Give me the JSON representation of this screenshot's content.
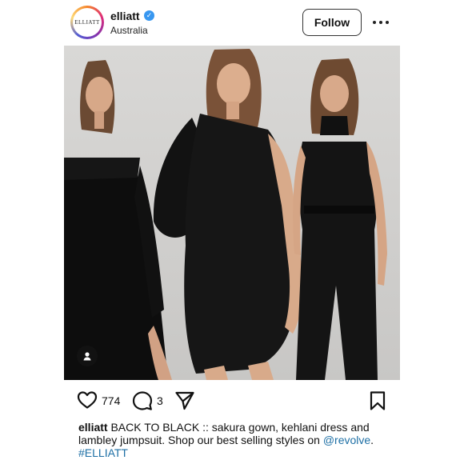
{
  "account": {
    "username": "elliatt",
    "avatar_text": "ELLIATT",
    "location": "Australia",
    "verified": true
  },
  "header": {
    "follow_label": "Follow",
    "more_icon": "more-horizontal-icon"
  },
  "photo": {
    "alt": "Three models in black outfits: off-shoulder gown, sequin one-shoulder dress, high-neck jumpsuit",
    "tag_icon": "user-tag-icon"
  },
  "actions": {
    "like_icon": "heart-icon",
    "like_count": "774",
    "comment_icon": "comment-icon",
    "comment_count": "3",
    "share_icon": "send-icon",
    "save_icon": "bookmark-icon"
  },
  "caption": {
    "username": "elliatt",
    "text": " BACK TO BLACK :: sakura gown, kehlani dress and lambley jumpsuit. Shop our best selling styles on ",
    "mention": "@revolve",
    "end": ".",
    "hashtag": "#ELLIATT"
  },
  "colors": {
    "link": "#1d6fa5",
    "verified": "#3897f0"
  }
}
